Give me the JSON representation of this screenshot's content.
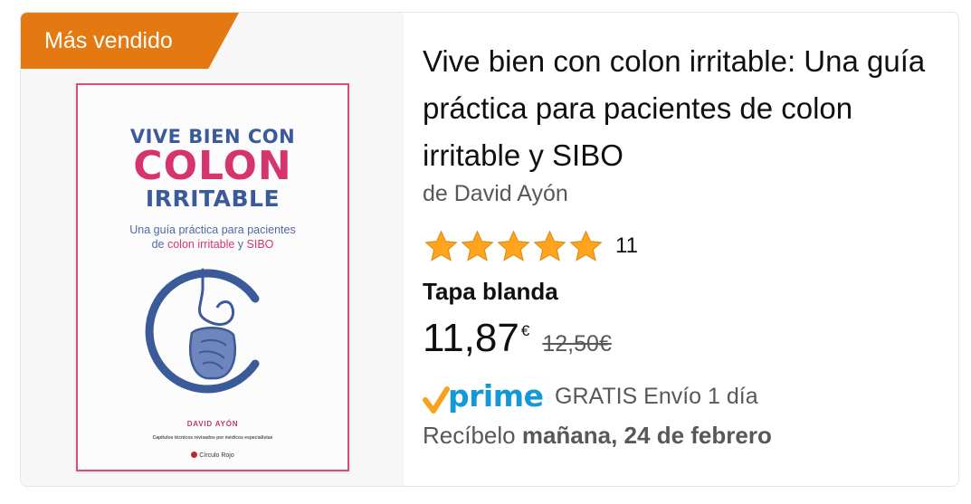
{
  "badge": {
    "label": "Más vendido"
  },
  "cover": {
    "line1": "VIVE BIEN CON",
    "line2": "COLON",
    "line3": "IRRITABLE",
    "sub1": "Una guía práctica para pacientes",
    "sub2_pre": "de ",
    "sub2_pink1": "colon irritable",
    "sub2_mid": " y ",
    "sub2_pink2": "SIBO",
    "author": "DAVID AYÓN",
    "note": "Capítulos técnicos revisados por médicos especialistas",
    "publisher": "Círculo Rojo",
    "colors": {
      "border": "#d24f80",
      "pink": "#d6346e",
      "blue": "#3b5a99"
    }
  },
  "product": {
    "title": "Vive bien con colon irritable: Una guía práctica para pacientes de colon irritable y SIBO",
    "author": "de David Ayón",
    "rating": {
      "stars": 5,
      "count": "11"
    },
    "format": "Tapa blanda",
    "price": {
      "whole": "11,87",
      "symbol": "€",
      "old": "12,50€"
    },
    "prime": {
      "logo": "prime",
      "shipping": "GRATIS Envío 1 día"
    },
    "delivery": {
      "prefix": "Recíbelo ",
      "date": "mañana, 24 de febrero"
    }
  },
  "colors": {
    "badge": "#e47911",
    "star": "#ffa41c",
    "prime": "#1399d6",
    "check": "#f7a21b"
  }
}
